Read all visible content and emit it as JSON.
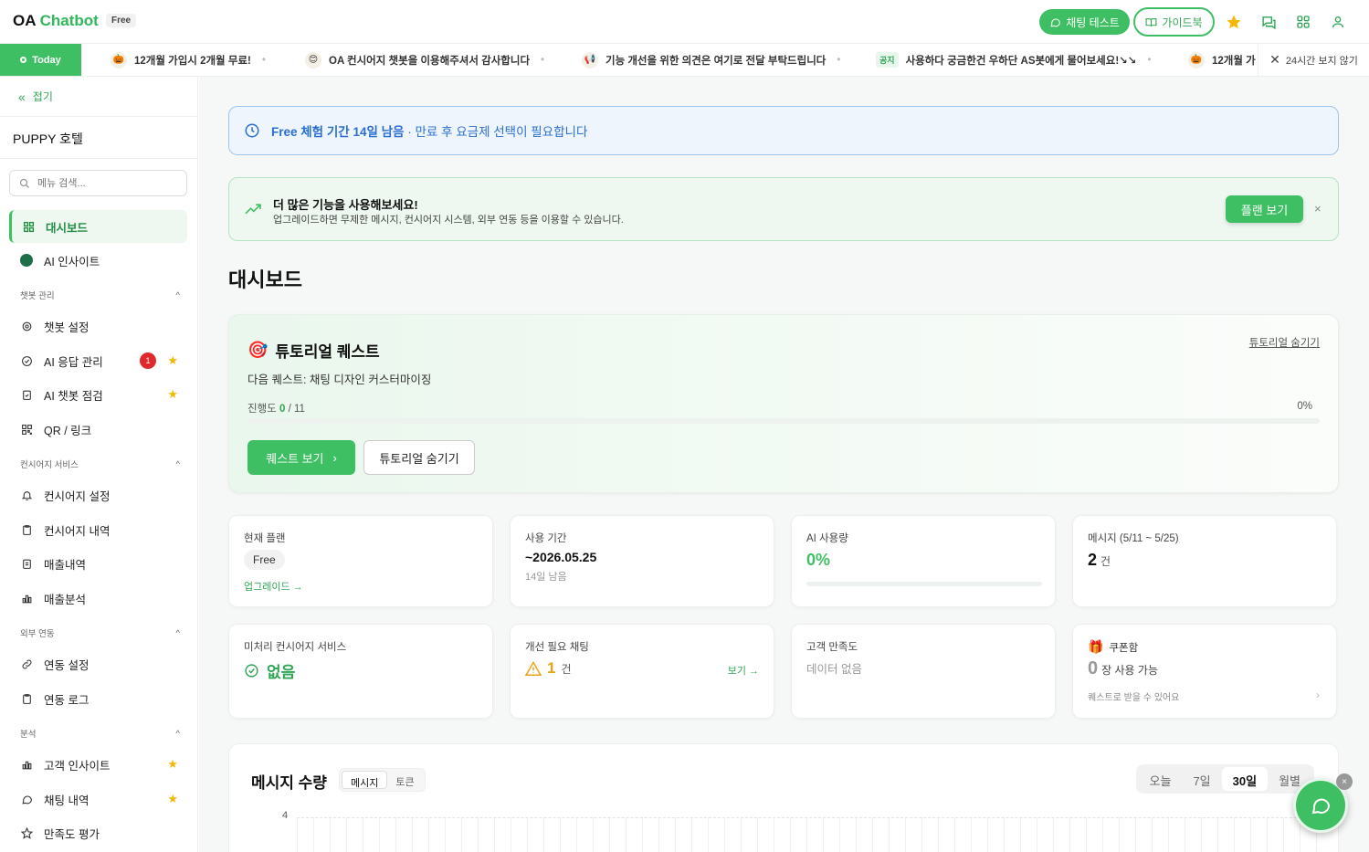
{
  "header": {
    "logo_prefix": "OA",
    "logo_name": "Chatbot",
    "plan_badge": "Free",
    "chat_test": "채팅 테스트",
    "guidebook": "가이드북"
  },
  "ticker": {
    "today": "Today",
    "items": [
      {
        "emoji": "🎃",
        "text": "12개월 가입시 2개월 무료!"
      },
      {
        "emoji": "😊",
        "text": "OA 컨시어지 챗봇을 이용해주셔서 감사합니다"
      },
      {
        "emoji": "📢",
        "text": "기능 개선을 위한 의견은 여기로 전달 부탁드립니다"
      },
      {
        "emoji": "공지",
        "text": "사용하다 궁금한건 우하단 AS봇에게 물어보세요!↘↘"
      },
      {
        "emoji": "🎃",
        "text": "12개월 가"
      }
    ],
    "hide24": "24시간 보지 않기"
  },
  "sidebar": {
    "fold": "접기",
    "hotel": "PUPPY 호텔",
    "search_placeholder": "메뉴 검색...",
    "dashboard": "대시보드",
    "ai_insight": "AI 인사이트",
    "sec_chatbot": "챗봇 관리",
    "chatbot_settings": "챗봇 설정",
    "ai_response": "AI 응답 관리",
    "ai_response_badge": "1",
    "ai_check": "AI 챗봇 점검",
    "qr_link": "QR / 링크",
    "sec_concierge": "컨시어지 서비스",
    "concierge_settings": "컨시어지 설정",
    "concierge_history": "컨시어지 내역",
    "sales_history": "매출내역",
    "sales_analysis": "매출분석",
    "sec_external": "외부 연동",
    "integration_settings": "연동 설정",
    "integration_log": "연동 로그",
    "sec_analysis": "분석",
    "customer_insight": "고객 인사이트",
    "chat_history": "채팅 내역",
    "satisfaction": "만족도 평가"
  },
  "trial": {
    "bold": "Free 체험 기간 14일 남음",
    "rest": " · 만료 후 요금제 선택이 필요합니다"
  },
  "upgrade": {
    "title": "더 많은 기능을 사용해보세요!",
    "sub": "업그레이드하면 무제한 메시지, 컨시어지 시스템, 외부 연동 등을 이용할 수 있습니다.",
    "plan_btn": "플랜 보기",
    "close": "×"
  },
  "page_title": "대시보드",
  "quest": {
    "title": "튜토리얼 퀘스트",
    "hide_link": "튜토리얼 숨기기",
    "next": "다음 퀘스트: 채팅 디자인 커스터마이징",
    "progress_label": "진행도",
    "progress_done": "0",
    "progress_total": "/ 11",
    "progress_pct": "0%",
    "progress_fraction": 0,
    "view_btn": "퀘스트 보기",
    "hide_btn": "튜토리얼 숨기기"
  },
  "cards": {
    "plan_label": "현재 플랜",
    "plan_value": "Free",
    "plan_link": "업그레이드 →",
    "period_label": "사용 기간",
    "period_value": "~2026.05.25",
    "period_sub": "14일 남음",
    "ai_label": "AI 사용량",
    "ai_value": "0%",
    "ai_fraction": 0,
    "msg_label": "메시지 (5/11 ~ 5/25)",
    "msg_value": "2",
    "msg_unit": "건",
    "unproc_label": "미처리 컨시어지 서비스",
    "unproc_value": "없음",
    "improve_label": "개선 필요 채팅",
    "improve_value": "1",
    "improve_unit": "건",
    "improve_link": "보기 →",
    "sat_label": "고객 만족도",
    "sat_value": "데이터 없음",
    "coupon_label": "쿠폰함",
    "coupon_value": "0",
    "coupon_unit": "장 사용 가능",
    "coupon_sub": "퀘스트로 받을 수 있어요"
  },
  "msgvol": {
    "title": "메시지 수량",
    "tab_msg": "메시지",
    "tab_token": "토큰",
    "r_today": "오늘",
    "r_7": "7일",
    "r_30": "30일",
    "r_month": "월별",
    "y_top": "4"
  },
  "colors": {
    "accent": "#3fbf63",
    "trial_blue": "#2a6fd0",
    "badge_red": "#e0282f",
    "star": "#f5b800"
  }
}
